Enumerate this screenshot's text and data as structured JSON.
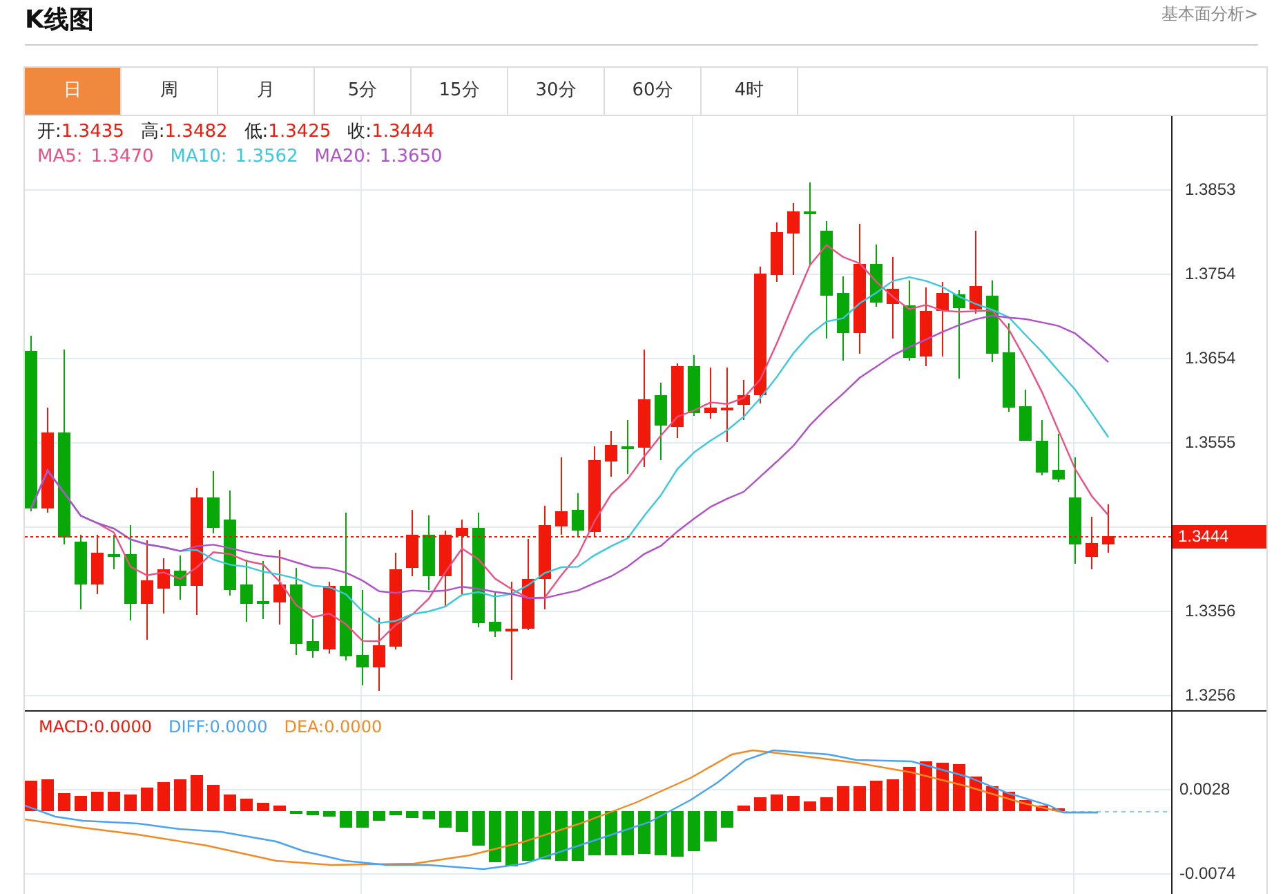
{
  "header": {
    "title": "K线图",
    "link": "基本面分析>"
  },
  "tabs": [
    {
      "label": "日",
      "selected": true
    },
    {
      "label": "周",
      "selected": false
    },
    {
      "label": "月",
      "selected": false
    },
    {
      "label": "5分",
      "selected": false
    },
    {
      "label": "15分",
      "selected": false
    },
    {
      "label": "30分",
      "selected": false
    },
    {
      "label": "60分",
      "selected": false
    },
    {
      "label": "4时",
      "selected": false
    }
  ],
  "legend": {
    "ohlc": [
      {
        "label": "开:",
        "value": "1.3435"
      },
      {
        "label": "高:",
        "value": "1.3482"
      },
      {
        "label": "低:",
        "value": "1.3425"
      },
      {
        "label": "收:",
        "value": "1.3444"
      }
    ],
    "moving_averages": [
      {
        "label": "MA5:",
        "value": "1.3470",
        "color": "#ee4f82"
      },
      {
        "label": "MA10:",
        "value": "1.3562",
        "color": "#3cc8dc"
      },
      {
        "label": "MA20:",
        "value": "1.3650",
        "color": "#b051c8"
      }
    ]
  },
  "price_axis": {
    "labels": [
      "1.3853",
      "1.3754",
      "1.3654",
      "1.3555",
      "1.3356",
      "1.3256"
    ],
    "current_price": "1.3444"
  },
  "macd": {
    "legend": [
      {
        "label": "MACD:",
        "value": "0.0000",
        "color": "#f0190a"
      },
      {
        "label": "DIFF:",
        "value": "0.0000",
        "color": "#4aa3f0"
      },
      {
        "label": "DEA:",
        "value": "0.0000",
        "color": "#f08a24"
      }
    ],
    "axis_labels": [
      "0.0028",
      "-0.0074"
    ]
  }
}
